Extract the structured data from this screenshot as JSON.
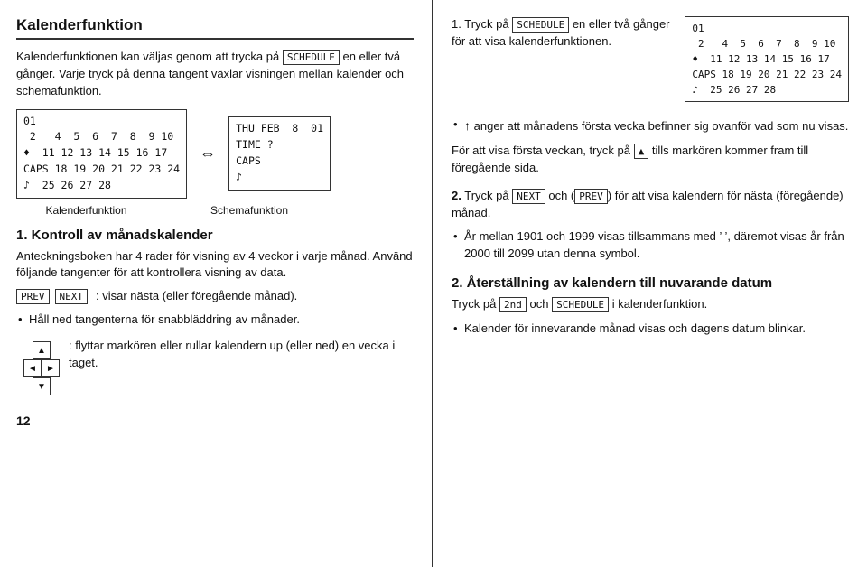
{
  "left": {
    "title": "Kalenderfunktion",
    "intro": "Kalenderfunktionen kan väljas genom att trycka på",
    "schedule_key": "SCHEDULE",
    "intro2": "en eller två gånger. Varje tryck på denna tangent växlar visningen mellan kalender och schemafunktion.",
    "cal_display": "01\n 2   4  5  6  7  8  9 10\n♦  11 12 13 14 15 16 17\nCAPS 18 19 20 21 22 23 24\n♪  25 26 27 28",
    "schema_display": "THU FEB  8  01\nTIME ?\nCAPS\n♪",
    "arrow_symbol": "⇔",
    "cal_label": "Kalenderfunktion",
    "schema_label": "Schemafunktion",
    "section1_title": "1. Kontroll av månadskalender",
    "section1_p1": "Anteckningsboken har 4 rader för visning av 4 veckor i varje månad. Använd följande tangenter för att kontrollera visning av data.",
    "prev_key": "PREV",
    "next_key": "NEXT",
    "nav_text": ": visar nästa (eller föregående månad).",
    "bullet1": "Håll ned tangenterna för snabbläddring av månader.",
    "arrow_keys_text": ": flyttar markören eller rullar kalendern up (eller ned) en vecka i taget.",
    "page_num": "12"
  },
  "right": {
    "intro_num": "1.",
    "intro_text": "Tryck på",
    "schedule_key": "SCHEDULE",
    "intro_text2": "en eller två gånger för att visa kalenderfunktionen.",
    "right_cal_display": "01\n 2   4  5  6  7  8  9 10\n♦  11 12 13 14 15 16 17\nCAPS 18 19 20 21 22 23 24\n♪  25 26 27 28",
    "bullet_up": "↑",
    "bullet1_text": "anger att månadens första vecka befinner sig ovanför vad som nu visas.",
    "bullet2_pre": "För att visa första veckan, tryck på",
    "bullet2_key": "▲",
    "bullet2_text": "tills markören kommer fram till föregående sida.",
    "item2_num": "2.",
    "item2_pre": "Tryck på",
    "item2_next": "NEXT",
    "item2_and": "och",
    "item2_prev": "PREV",
    "item2_text": "för att visa kalendern för nästa (föregående) månad.",
    "bullet3": "År mellan 1901 och 1999 visas tillsammans med ’ ’, däremot visas år från 2000 till 2099 utan denna symbol.",
    "section2_title": "2. Återställning av kalendern till nuvarande datum",
    "section2_p1": "Tryck på",
    "section2_2nd": "2nd",
    "section2_and": "och",
    "section2_schedule": "SCHEDULE",
    "section2_p1_end": "i kalenderfunktion.",
    "section2_bullet": "Kalender för innevarande månad visas och dagens datum blinkar."
  }
}
